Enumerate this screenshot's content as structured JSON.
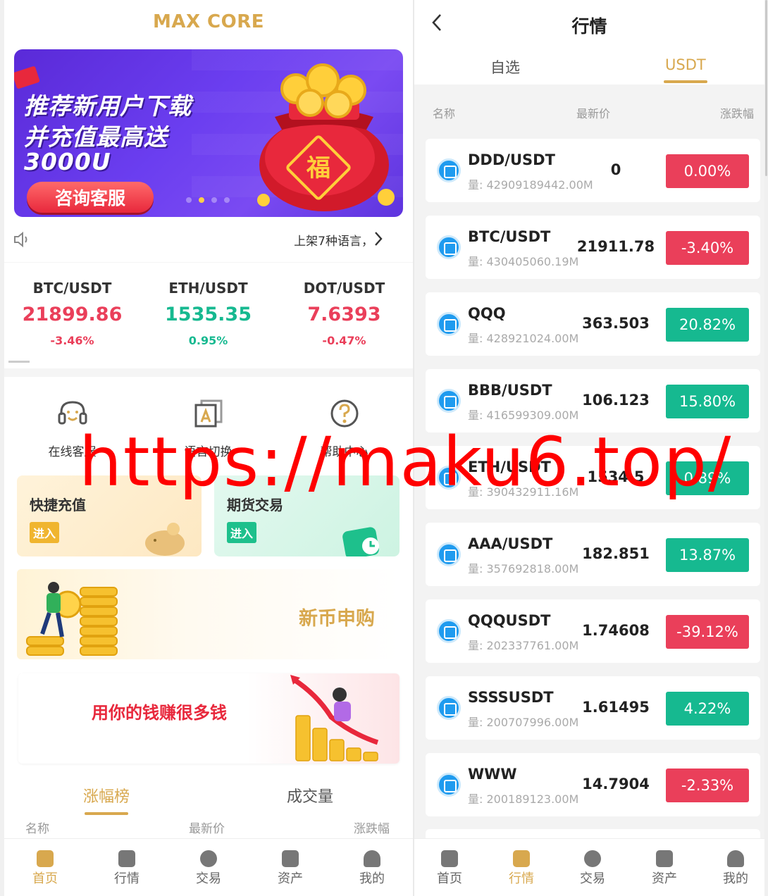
{
  "colors": {
    "accent": "#d8a84e",
    "up": "#16b990",
    "down": "#ea3f5a",
    "brand_red": "#e8283c"
  },
  "left": {
    "brand": "MAX CORE",
    "banner": {
      "line1": "推荐新用户下载",
      "line2": "并充值最高送",
      "line3": "3000U",
      "cta": "咨询客服",
      "bag_char": "福"
    },
    "notice": {
      "icon": "speaker-icon",
      "text": "上架7种语言，"
    },
    "tickers": [
      {
        "pair": "BTC/USDT",
        "price": "21899.86",
        "change": "-3.46%",
        "dir": "down"
      },
      {
        "pair": "ETH/USDT",
        "price": "1535.35",
        "change": "0.95%",
        "dir": "up"
      },
      {
        "pair": "DOT/USDT",
        "price": "7.6393",
        "change": "-0.47%",
        "dir": "down"
      }
    ],
    "shortcuts": [
      {
        "label": "在线客服",
        "icon": "headset-icon"
      },
      {
        "label": "语言切换",
        "icon": "language-icon"
      },
      {
        "label": "帮助中心",
        "icon": "help-icon"
      }
    ],
    "cards": {
      "recharge": {
        "title": "快捷充值",
        "button": "进入"
      },
      "futures": {
        "title": "期货交易",
        "button": "进入"
      }
    },
    "promo_new_coin": "新币申购",
    "promo_earn": "用你的钱赚很多钱",
    "ranking_tabs": [
      "涨幅榜",
      "成交量"
    ],
    "ranking_headers": [
      "名称",
      "最新价",
      "涨跌幅"
    ],
    "tabbar": [
      {
        "label": "首页",
        "icon": "home-icon",
        "active": true
      },
      {
        "label": "行情",
        "icon": "chart-icon",
        "active": false
      },
      {
        "label": "交易",
        "icon": "exchange-icon",
        "active": false
      },
      {
        "label": "资产",
        "icon": "wallet-icon",
        "active": false
      },
      {
        "label": "我的",
        "icon": "user-icon",
        "active": false
      }
    ]
  },
  "right": {
    "title": "行情",
    "tabs": [
      "自选",
      "USDT"
    ],
    "active_tab": "USDT",
    "headers": [
      "名称",
      "最新价",
      "涨跌幅"
    ],
    "rows": [
      {
        "symbol": "DDD/USDT",
        "volume": "量: 42909189442.00M",
        "last": "0",
        "change": "0.00%",
        "dir": "down"
      },
      {
        "symbol": "BTC/USDT",
        "volume": "量: 430405060.19M",
        "last": "21911.78",
        "change": "-3.40%",
        "dir": "down"
      },
      {
        "symbol": "QQQ",
        "volume": "量: 428921024.00M",
        "last": "363.503",
        "change": "20.82%",
        "dir": "up"
      },
      {
        "symbol": "BBB/USDT",
        "volume": "量: 416599309.00M",
        "last": "106.123",
        "change": "15.80%",
        "dir": "up"
      },
      {
        "symbol": "ETH/USDT",
        "volume": "量: 390432911.16M",
        "last": "1534.5",
        "change": "0.89%",
        "dir": "up"
      },
      {
        "symbol": "AAA/USDT",
        "volume": "量: 357692818.00M",
        "last": "182.851",
        "change": "13.87%",
        "dir": "up"
      },
      {
        "symbol": "QQQUSDT",
        "volume": "量: 202337761.00M",
        "last": "1.74608",
        "change": "-39.12%",
        "dir": "down"
      },
      {
        "symbol": "SSSSUSDT",
        "volume": "量: 200707996.00M",
        "last": "1.61495",
        "change": "4.22%",
        "dir": "up"
      },
      {
        "symbol": "WWW",
        "volume": "量: 200189123.00M",
        "last": "14.7904",
        "change": "-2.33%",
        "dir": "down"
      }
    ],
    "tabbar": [
      {
        "label": "首页",
        "icon": "home-icon",
        "active": false
      },
      {
        "label": "行情",
        "icon": "chart-icon",
        "active": true
      },
      {
        "label": "交易",
        "icon": "exchange-icon",
        "active": false
      },
      {
        "label": "资产",
        "icon": "wallet-icon",
        "active": false
      },
      {
        "label": "我的",
        "icon": "user-icon",
        "active": false
      }
    ]
  },
  "watermark": "https://maku6.top/"
}
